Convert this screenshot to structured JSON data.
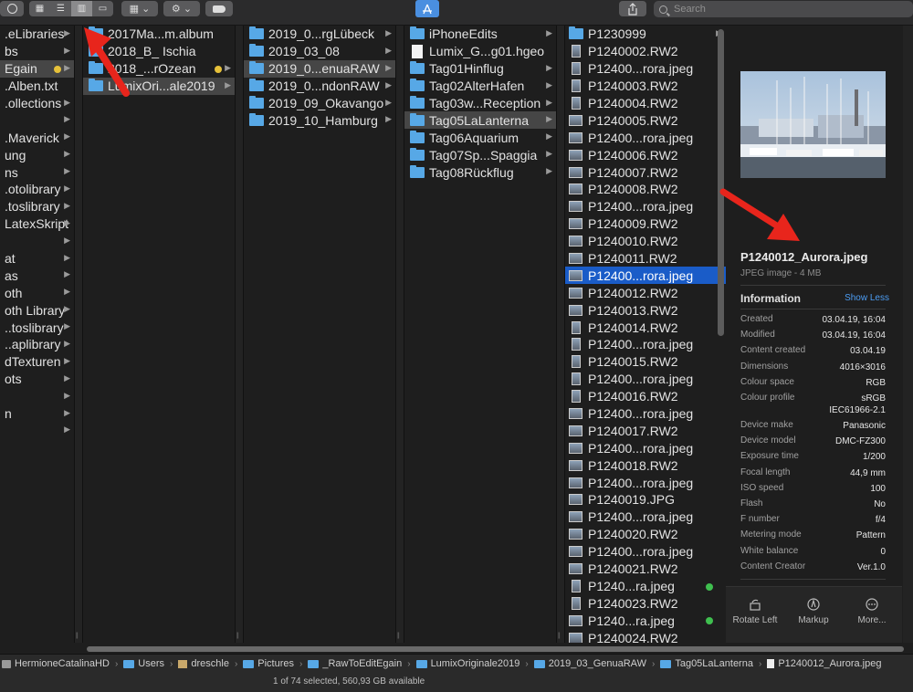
{
  "toolbar": {
    "view_modes": [
      "icon",
      "list",
      "column",
      "gallery"
    ],
    "active_view": "column",
    "search_placeholder": "Search"
  },
  "columns": {
    "sidebar": {
      "items": [
        {
          "label": ".eLibraries",
          "chevron": true
        },
        {
          "label": "bs",
          "chevron": true
        },
        {
          "label": "Egain",
          "chevron": true,
          "selected": "gray",
          "tag": "#e6c13a"
        },
        {
          "label": ".Alben.txt",
          "chevron": false
        },
        {
          "label": ".ollections",
          "chevron": true
        },
        {
          "label": "",
          "chevron": true
        },
        {
          "label": ".Maverick",
          "chevron": true
        },
        {
          "label": "ung",
          "chevron": true
        },
        {
          "label": "ns",
          "chevron": true
        },
        {
          "label": ".otolibrary",
          "chevron": true
        },
        {
          "label": ".toslibrary",
          "chevron": true
        },
        {
          "label": "LatexSkript",
          "chevron": true
        },
        {
          "label": "",
          "chevron": true
        },
        {
          "label": "at",
          "chevron": true
        },
        {
          "label": "as",
          "chevron": true
        },
        {
          "label": "oth",
          "chevron": true
        },
        {
          "label": "oth Library",
          "chevron": true
        },
        {
          "label": "..toslibrary",
          "chevron": true
        },
        {
          "label": "..aplibrary",
          "chevron": true
        },
        {
          "label": "dTexturen",
          "chevron": true
        },
        {
          "label": "ots",
          "chevron": true
        },
        {
          "label": "",
          "chevron": true
        },
        {
          "label": "n",
          "chevron": true
        },
        {
          "label": "",
          "chevron": true
        }
      ]
    },
    "col2": {
      "items": [
        {
          "label": "2017Ma...m.album",
          "chevron": false
        },
        {
          "label": "2018_B_ Ischia",
          "chevron": false
        },
        {
          "label": "2018_...rOzean",
          "chevron": true,
          "tag": "#e6c13a"
        },
        {
          "label": "LumixOri...ale2019",
          "chevron": true,
          "selected": "gray"
        }
      ]
    },
    "col3": {
      "items": [
        {
          "label": "2019_0...rgLübeck",
          "chevron": true
        },
        {
          "label": "2019_03_08",
          "chevron": true
        },
        {
          "label": "2019_0...enuaRAW",
          "chevron": true,
          "selected": "gray"
        },
        {
          "label": "2019_0...ndonRAW",
          "chevron": true
        },
        {
          "label": "2019_09_Okavango",
          "chevron": true
        },
        {
          "label": "2019_10_Hamburg",
          "chevron": true
        }
      ]
    },
    "col4": {
      "items": [
        {
          "label": "iPhoneEdits",
          "icon": "folder",
          "chevron": true
        },
        {
          "label": "Lumix_G...g01.hgeo",
          "icon": "doc",
          "chevron": false
        },
        {
          "label": "Tag01Hinflug",
          "icon": "folder",
          "chevron": true
        },
        {
          "label": "Tag02AlterHafen",
          "icon": "folder",
          "chevron": true
        },
        {
          "label": "Tag03w...Reception",
          "icon": "folder",
          "chevron": true
        },
        {
          "label": "Tag05LaLanterna",
          "icon": "folder",
          "chevron": true,
          "selected": "gray"
        },
        {
          "label": "Tag06Aquarium",
          "icon": "folder",
          "chevron": true
        },
        {
          "label": "Tag07Sp...Spaggia",
          "icon": "folder",
          "chevron": true
        },
        {
          "label": "Tag08Rückflug",
          "icon": "folder",
          "chevron": true
        }
      ]
    },
    "files": {
      "items": [
        {
          "label": "P1230999",
          "icon": "folder",
          "chevron": true
        },
        {
          "label": "P1240002.RW2",
          "icon": "portrait"
        },
        {
          "label": "P12400...rora.jpeg",
          "icon": "portrait"
        },
        {
          "label": "P1240003.RW2",
          "icon": "portrait"
        },
        {
          "label": "P1240004.RW2",
          "icon": "portrait"
        },
        {
          "label": "P1240005.RW2",
          "icon": "thumb"
        },
        {
          "label": "P12400...rora.jpeg",
          "icon": "thumb"
        },
        {
          "label": "P1240006.RW2",
          "icon": "thumb"
        },
        {
          "label": "P1240007.RW2",
          "icon": "thumb"
        },
        {
          "label": "P1240008.RW2",
          "icon": "thumb"
        },
        {
          "label": "P12400...rora.jpeg",
          "icon": "thumb"
        },
        {
          "label": "P1240009.RW2",
          "icon": "thumb"
        },
        {
          "label": "P1240010.RW2",
          "icon": "thumb"
        },
        {
          "label": "P1240011.RW2",
          "icon": "thumb"
        },
        {
          "label": "P12400...rora.jpeg",
          "icon": "thumb",
          "selected": "blue"
        },
        {
          "label": "P1240012.RW2",
          "icon": "thumb"
        },
        {
          "label": "P1240013.RW2",
          "icon": "thumb"
        },
        {
          "label": "P1240014.RW2",
          "icon": "portrait"
        },
        {
          "label": "P12400...rora.jpeg",
          "icon": "portrait"
        },
        {
          "label": "P1240015.RW2",
          "icon": "portrait"
        },
        {
          "label": "P12400...rora.jpeg",
          "icon": "portrait"
        },
        {
          "label": "P1240016.RW2",
          "icon": "portrait"
        },
        {
          "label": "P12400...rora.jpeg",
          "icon": "thumb"
        },
        {
          "label": "P1240017.RW2",
          "icon": "thumb"
        },
        {
          "label": "P12400...rora.jpeg",
          "icon": "thumb"
        },
        {
          "label": "P1240018.RW2",
          "icon": "thumb"
        },
        {
          "label": "P12400...rora.jpeg",
          "icon": "thumb"
        },
        {
          "label": "P1240019.JPG",
          "icon": "thumb"
        },
        {
          "label": "P12400...rora.jpeg",
          "icon": "thumb"
        },
        {
          "label": "P1240020.RW2",
          "icon": "thumb"
        },
        {
          "label": "P12400...rora.jpeg",
          "icon": "thumb"
        },
        {
          "label": "P1240021.RW2",
          "icon": "thumb"
        },
        {
          "label": "P1240...ra.jpeg",
          "icon": "portrait",
          "tag": "#3fbf4f"
        },
        {
          "label": "P1240023.RW2",
          "icon": "portrait"
        },
        {
          "label": "P1240...ra.jpeg",
          "icon": "thumb",
          "tag": "#3fbf4f"
        },
        {
          "label": "P1240024.RW2",
          "icon": "thumb"
        },
        {
          "label": "P1240...ra.jpeg",
          "icon": "thumb",
          "tag": "#3fbf4f"
        }
      ]
    }
  },
  "preview": {
    "filename": "P1240012_Aurora.jpeg",
    "kind": "JPEG image - 4 MB",
    "info_title": "Information",
    "show_less": "Show Less",
    "info": [
      {
        "k": "Created",
        "v": "03.04.19, 16:04"
      },
      {
        "k": "Modified",
        "v": "03.04.19, 16:04"
      },
      {
        "k": "Content created",
        "v": "03.04.19"
      },
      {
        "k": "Dimensions",
        "v": "4016×3016"
      },
      {
        "k": "Colour space",
        "v": "RGB"
      },
      {
        "k": "Colour profile",
        "v": "sRGB\nIEC61966-2.1"
      },
      {
        "k": "Device make",
        "v": "Panasonic"
      },
      {
        "k": "Device model",
        "v": "DMC-FZ300"
      },
      {
        "k": "Exposure time",
        "v": "1/200"
      },
      {
        "k": "Focal length",
        "v": "44,9 mm"
      },
      {
        "k": "ISO speed",
        "v": "100"
      },
      {
        "k": "Flash",
        "v": "No"
      },
      {
        "k": "F number",
        "v": "f/4"
      },
      {
        "k": "Metering mode",
        "v": "Pattern"
      },
      {
        "k": "White balance",
        "v": "0"
      },
      {
        "k": "Content Creator",
        "v": "Ver.1.0"
      }
    ],
    "actions": {
      "rotate": "Rotate Left",
      "markup": "Markup",
      "more": "More..."
    }
  },
  "pathbar": {
    "segments": [
      {
        "label": "HermioneCatalinaHD",
        "icon": "disk"
      },
      {
        "label": "Users",
        "icon": "folder"
      },
      {
        "label": "dreschle",
        "icon": "home"
      },
      {
        "label": "Pictures",
        "icon": "folder"
      },
      {
        "label": "_RawToEditEgain",
        "icon": "folder"
      },
      {
        "label": "LumixOriginale2019",
        "icon": "folder"
      },
      {
        "label": "2019_03_GenuaRAW",
        "icon": "folder"
      },
      {
        "label": "Tag05LaLanterna",
        "icon": "folder"
      },
      {
        "label": "P1240012_Aurora.jpeg",
        "icon": "doc"
      }
    ]
  },
  "status": "1 of 74 selected, 560,93 GB available",
  "colors": {
    "selection_blue": "#1a5cc8",
    "folder_blue": "#57a8e6",
    "annotation_red": "#e8251c"
  }
}
